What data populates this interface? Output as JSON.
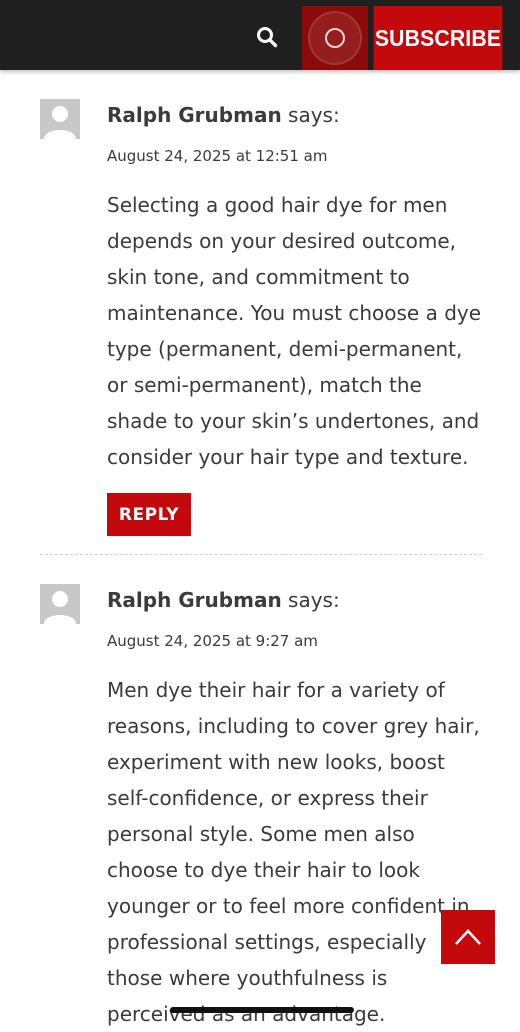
{
  "header": {
    "search_icon": "search-icon",
    "live_icon": "live-circle-icon",
    "subscribe_label": "SUBSCRIBE",
    "brand_color": "#c4090d",
    "bar_color": "#1f1f1f"
  },
  "comments": [
    {
      "author": "Ralph Grubman",
      "says": "says:",
      "date": "August 24, 2025 at 12:51 am",
      "text": "Selecting a good hair dye for men depends on your desired outcome, skin tone, and commitment to maintenance. You must choose a dye type (permanent, demi-permanent, or semi-permanent), match the shade to your skin’s undertones, and consider your hair type and texture.",
      "reply_label": "REPLY"
    },
    {
      "author": "Ralph Grubman",
      "says": "says:",
      "date": "August 24, 2025 at 9:27 am",
      "text": "Men dye their hair for a variety of reasons, including to cover grey hair, experiment with new looks, boost self-confidence, or express their personal style. Some men also choose to dye their hair to look younger or to feel more confident in professional settings, especially those where youthfulness is perceived as an advantage."
    }
  ],
  "scroll_top_icon": "chevron-up-icon"
}
